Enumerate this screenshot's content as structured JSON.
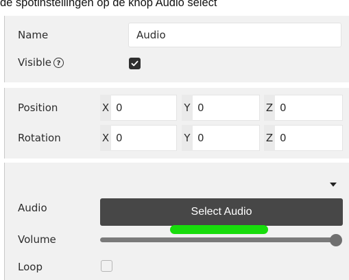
{
  "caption": "de spotinstellingen op de knop Audio select",
  "general": {
    "name_label": "Name",
    "name_value": "Audio",
    "visible_label": "Visible",
    "help_symbol": "?",
    "visible_checked": true
  },
  "transform": {
    "position_label": "Position",
    "rotation_label": "Rotation",
    "position": {
      "x_label": "X",
      "x": "0",
      "y_label": "Y",
      "y": "0",
      "z_label": "Z",
      "z": "0"
    },
    "rotation": {
      "x_label": "X",
      "x": "0",
      "y_label": "Y",
      "y": "0",
      "z_label": "Z",
      "z": "0"
    }
  },
  "audio": {
    "audio_label": "Audio",
    "select_button_label": "Select Audio",
    "volume_label": "Volume",
    "volume_level": 1.0,
    "loop_label": "Loop",
    "loop_checked": false
  },
  "colors": {
    "button_bg": "#474747",
    "highlight": "#18dc0c",
    "panel_bg": "#f1f1f1"
  }
}
